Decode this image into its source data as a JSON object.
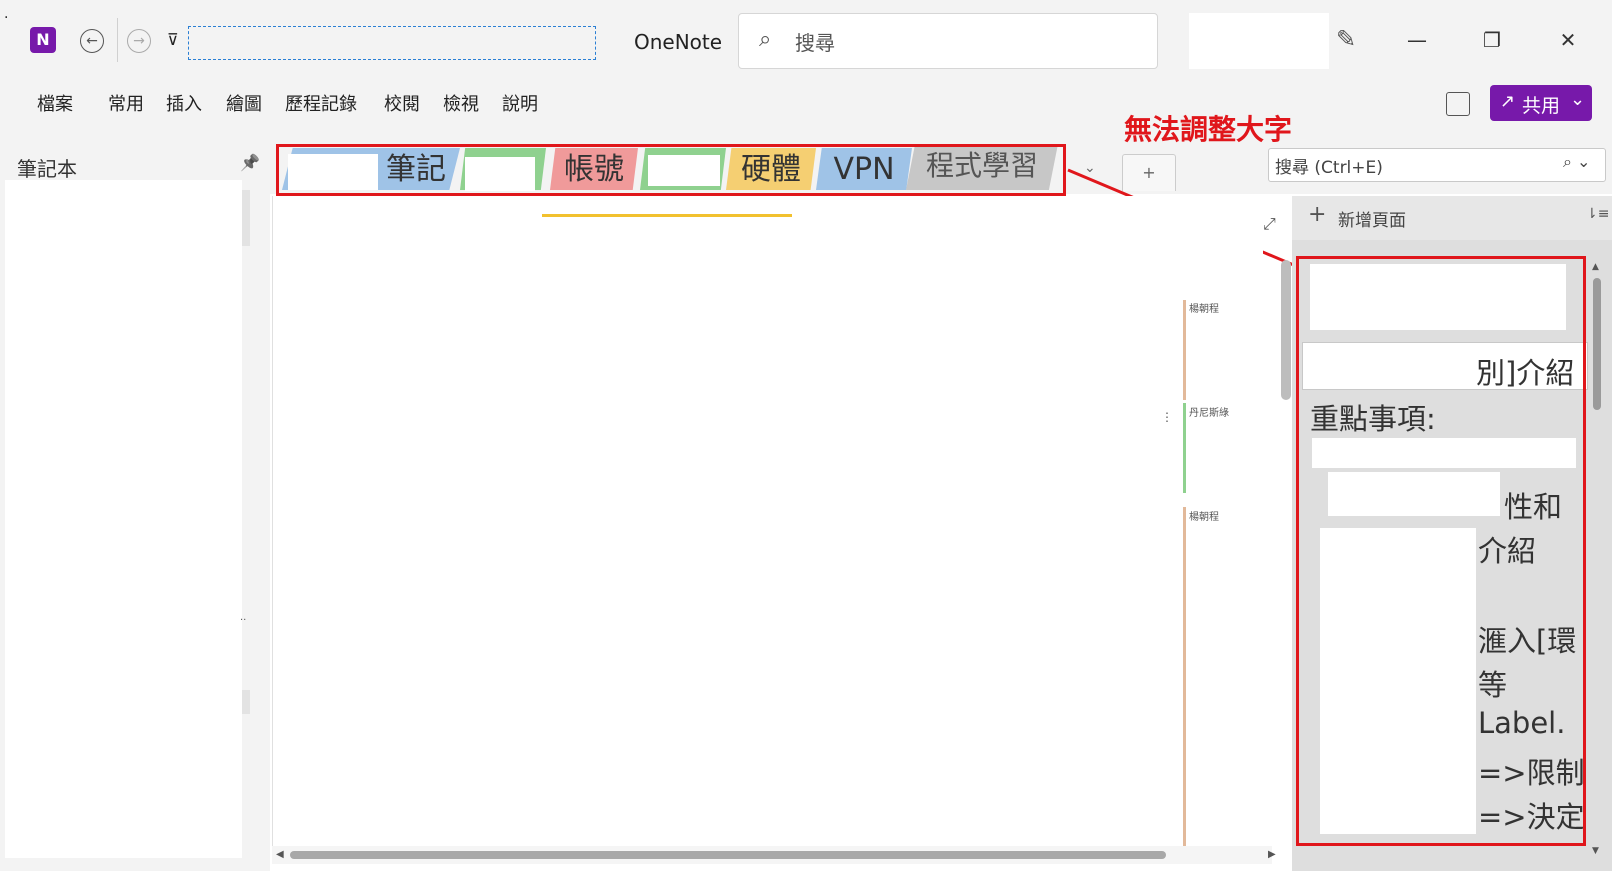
{
  "app": {
    "name": "OneNote",
    "logo_letter": "N",
    "title_dots": "·",
    "search_placeholder": "搜尋"
  },
  "nav": {
    "back_icon": "←",
    "forward_icon": "→",
    "qat_icon": "⊽"
  },
  "window": {
    "pen_icon": "✎",
    "minimize": "—",
    "maximize": "❐",
    "close": "✕"
  },
  "menu": {
    "items": [
      "檔案",
      "常用",
      "插入",
      "繪圖",
      "歷程記錄",
      "校閱",
      "檢視",
      "說明"
    ],
    "share_label": "共用",
    "share_chevron": "⌄"
  },
  "left": {
    "header": "筆記本",
    "pin_icon": "📌",
    "dots": "··"
  },
  "tabs": [
    {
      "label": "筆記",
      "color": "#9fc3e7"
    },
    {
      "label": "",
      "color": "#8fd18f"
    },
    {
      "label": "帳號",
      "color": "#f09a9a"
    },
    {
      "label": "",
      "color": "#8fd18f"
    },
    {
      "label": "硬體",
      "color": "#f5cf72"
    },
    {
      "label": "VPN",
      "color": "#9fc3e7"
    },
    {
      "label": "程式學習",
      "color": "#c7c7c7"
    }
  ],
  "tab_extras": {
    "dropdown": "⌄",
    "add": "+"
  },
  "annotation": {
    "text": "無法調整大字",
    "color": "#e0161b"
  },
  "search": {
    "placeholder": "搜尋 (Ctrl+E)",
    "icon": "⌕ ⌄"
  },
  "pages": {
    "add_label": "新增頁面",
    "add_icon": "+",
    "sort_icon": "⇂≡",
    "lines": [
      "別]介紹",
      "重點事項:",
      "性和",
      "介紹",
      "滙入[環",
      "等",
      "Label.",
      "=>限制",
      "=>決定"
    ]
  },
  "canvas": {
    "expand_icon": "⤢",
    "labels": [
      "楊朝程",
      "丹尼斯綠",
      "楊朝程"
    ],
    "side_mark": "⋮",
    "accent_color": "#f2c12e"
  },
  "scroll": {
    "left_arrow": "◀",
    "right_arrow": "▶",
    "up_arrow": "▲",
    "down_arrow": "▼"
  }
}
